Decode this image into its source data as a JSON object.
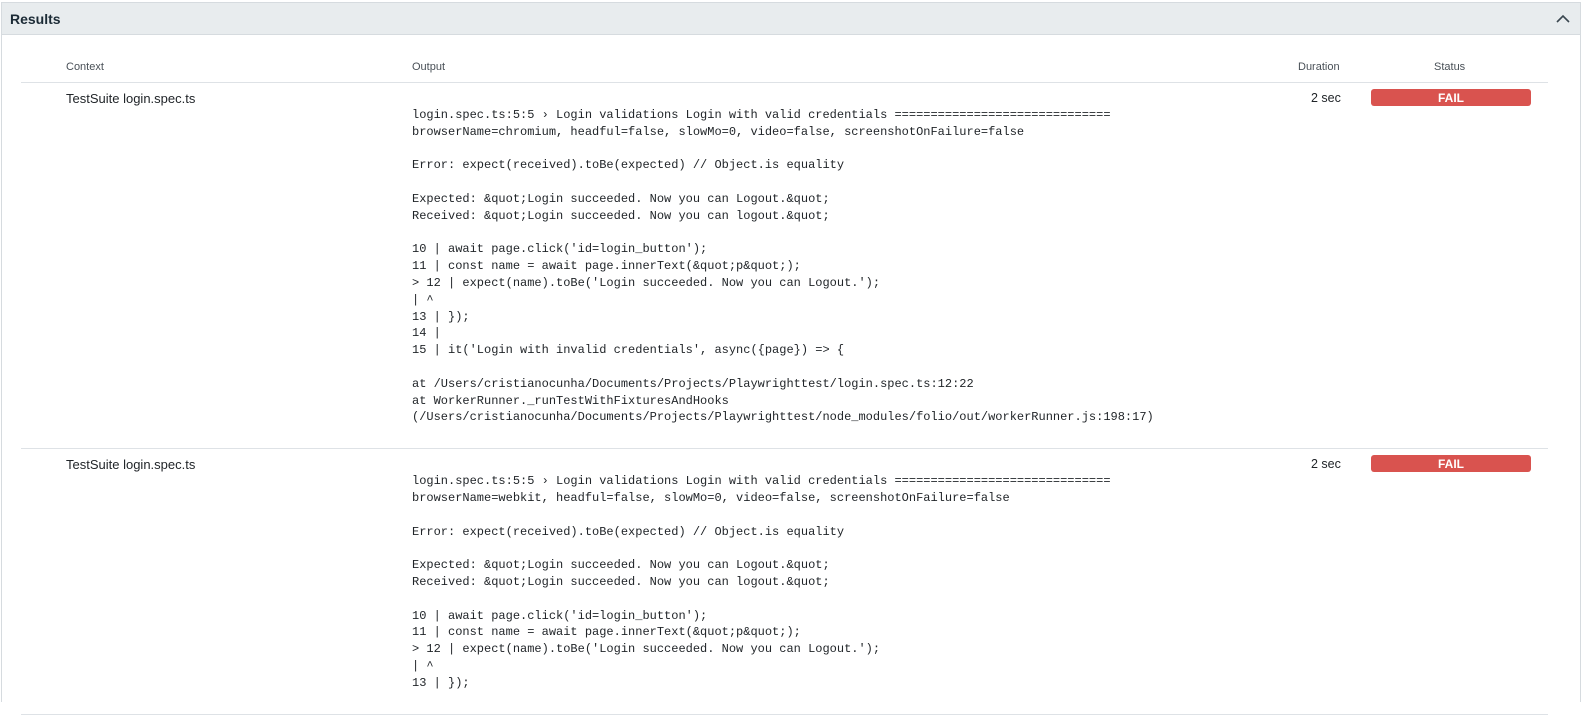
{
  "panel": {
    "title": "Results"
  },
  "icons": {
    "collapse": "chevron-up-icon"
  },
  "columns": {
    "context": "Context",
    "output": "Output",
    "duration": "Duration",
    "status": "Status"
  },
  "colors": {
    "fail": "#d9534f",
    "header_bg": "#e8ecee"
  },
  "rows": [
    {
      "context": "TestSuite login.spec.ts",
      "duration": "2 sec",
      "status": "FAIL",
      "output": [
        "login.spec.ts:5:5 › Login validations Login with valid credentials ==============================",
        "browserName=chromium, headful=false, slowMo=0, video=false, screenshotOnFailure=false",
        "",
        "Error: expect(received).toBe(expected) // Object.is equality",
        "",
        "Expected: &quot;Login succeeded. Now you can Logout.&quot;",
        "Received: &quot;Login succeeded. Now you can logout.&quot;",
        "",
        "10 | await page.click('id=login_button');",
        "11 | const name = await page.innerText(&quot;p&quot;);",
        "> 12 | expect(name).toBe('Login succeeded. Now you can Logout.');",
        "| ^",
        "13 | });",
        "14 |",
        "15 | it('Login with invalid credentials', async({page}) => {",
        "",
        "at /Users/cristianocunha/Documents/Projects/Playwrighttest/login.spec.ts:12:22",
        "at WorkerRunner._runTestWithFixturesAndHooks",
        "(/Users/cristianocunha/Documents/Projects/Playwrighttest/node_modules/folio/out/workerRunner.js:198:17)"
      ]
    },
    {
      "context": "TestSuite login.spec.ts",
      "duration": "2 sec",
      "status": "FAIL",
      "output": [
        "login.spec.ts:5:5 › Login validations Login with valid credentials ==============================",
        "browserName=webkit, headful=false, slowMo=0, video=false, screenshotOnFailure=false",
        "",
        "Error: expect(received).toBe(expected) // Object.is equality",
        "",
        "Expected: &quot;Login succeeded. Now you can Logout.&quot;",
        "Received: &quot;Login succeeded. Now you can logout.&quot;",
        "",
        "10 | await page.click('id=login_button');",
        "11 | const name = await page.innerText(&quot;p&quot;);",
        "> 12 | expect(name).toBe('Login succeeded. Now you can Logout.');",
        "| ^",
        "13 | });"
      ]
    }
  ]
}
